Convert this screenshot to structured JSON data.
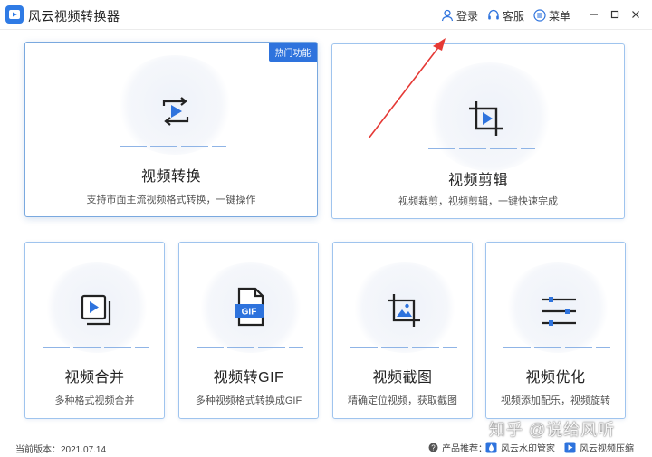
{
  "app": {
    "title": "风云视频转换器"
  },
  "topbar": {
    "login_label": "登录",
    "service_label": "客服",
    "menu_label": "菜单"
  },
  "cards": {
    "convert": {
      "title": "视频转换",
      "desc": "支持市面主流视频格式转换，一键操作",
      "badge": "热门功能"
    },
    "edit": {
      "title": "视频剪辑",
      "desc": "视频裁剪，视频剪辑，一键快速完成"
    },
    "merge": {
      "title": "视频合并",
      "desc": "多种格式视频合并"
    },
    "gif": {
      "title": "视频转GIF",
      "desc": "多种视频格式转换成GIF",
      "icon_text": "GIF"
    },
    "capture": {
      "title": "视频截图",
      "desc": "精确定位视频，获取截图"
    },
    "optimize": {
      "title": "视频优化",
      "desc": "视频添加配乐，视频旋转"
    }
  },
  "footer": {
    "version": "当前版本：2021.07.14",
    "recommend_label": "产品推荐：",
    "product1": "风云水印管家",
    "product2": "风云视频压缩"
  },
  "watermark": "知乎 @说给风听",
  "colors": {
    "accent": "#2e73dd",
    "card_border": "#9fc4ee",
    "annotation_arrow": "#e53935"
  },
  "icons": {
    "logo": "app-logo-icon",
    "login": "user-icon",
    "service": "headset-icon",
    "menu": "menu-icon",
    "minimize": "minimize-icon",
    "maximize": "maximize-icon",
    "close": "close-icon"
  }
}
